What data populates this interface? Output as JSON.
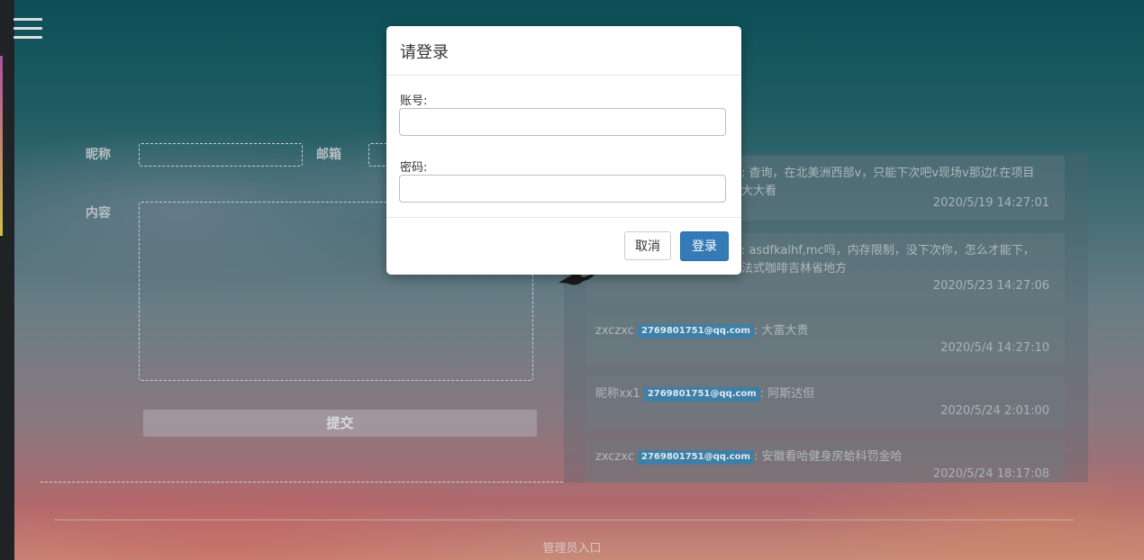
{
  "form": {
    "nickname_label": "昵称",
    "email_label": "邮箱",
    "content_label": "内容",
    "submit_label": "提交"
  },
  "messages": [
    {
      "text": ": 杳询，在北美洲西部v，只能下次吧v现场v那边f.在项目",
      "text2": "大大看",
      "time": "2020/5/19 14:27:01"
    },
    {
      "text": ": asdfkalhf,mc吗，内存限制，没下次你，怎么才能下，",
      "text2": "法式咖啡吉林省地方",
      "time": "2020/5/23 14:27:06"
    },
    {
      "name": "zxczxc",
      "email": "2769801751@qq.com",
      "text": ": 大富大贵",
      "time": "2020/5/4 14:27:10"
    },
    {
      "name": "昵称xx1",
      "email": "2769801751@qq.com",
      "text": ": 阿斯达但",
      "time": "2020/5/24 2:01:00"
    },
    {
      "name": "zxczxc",
      "email": "2769801751@qq.com",
      "text": ": 安徽看哈健身房蛤科罚金哈",
      "time": "2020/5/24 18:17:08"
    }
  ],
  "footer": {
    "admin_link": "管理员入口"
  },
  "login_modal": {
    "title": "请登录",
    "account_label": "账号:",
    "account_value": "",
    "password_label": "密码:",
    "password_value": "",
    "cancel_label": "取消",
    "login_label": "登录"
  },
  "colors": {
    "primary": "#337ab7",
    "badge": "#3e7fa6"
  },
  "icons": {
    "menu": "hamburger-menu-icon",
    "bird": "bird-silhouette"
  }
}
